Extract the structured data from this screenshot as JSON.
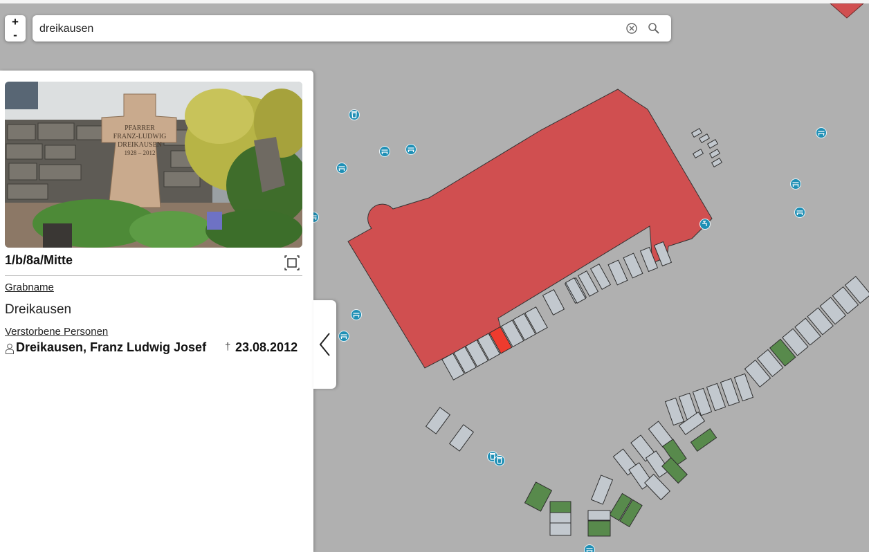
{
  "colors": {
    "map_background": "#b0b0b0",
    "church": "#d04f50",
    "grave": "#c2c8ce",
    "grave_occupied": "#588a4c",
    "grave_selected": "#ee3b2e",
    "poi": "#1f8fb5"
  },
  "search": {
    "value": "dreikausen",
    "placeholder": ""
  },
  "zoom": {
    "in_label": "+",
    "out_label": "-"
  },
  "icons": {
    "clear": "circle-x-icon",
    "search": "magnifier-icon",
    "zoom_to": "zoom-to-extent-icon",
    "person": "person-icon",
    "death": "dagger-cross-icon",
    "collapse": "chevron-left-icon",
    "poi": [
      "trash-bin-icon",
      "bench-icon",
      "water-tap-icon"
    ]
  },
  "panel": {
    "photo_alt": "grave photo",
    "cross_inscription": [
      "PFARRER",
      "FRANZ-LUDWIG",
      "DREIKAUSEN",
      "1928 – 2012"
    ],
    "grave_id": "1/b/8a/Mitte",
    "grave_name_label": "Grabname",
    "grave_name": "Dreikausen",
    "deceased_label": "Verstorbene Personen",
    "deceased": [
      {
        "name": "Dreikausen, Franz Ludwig Josef",
        "death_symbol": "†",
        "date": "23.08.2012"
      }
    ]
  }
}
